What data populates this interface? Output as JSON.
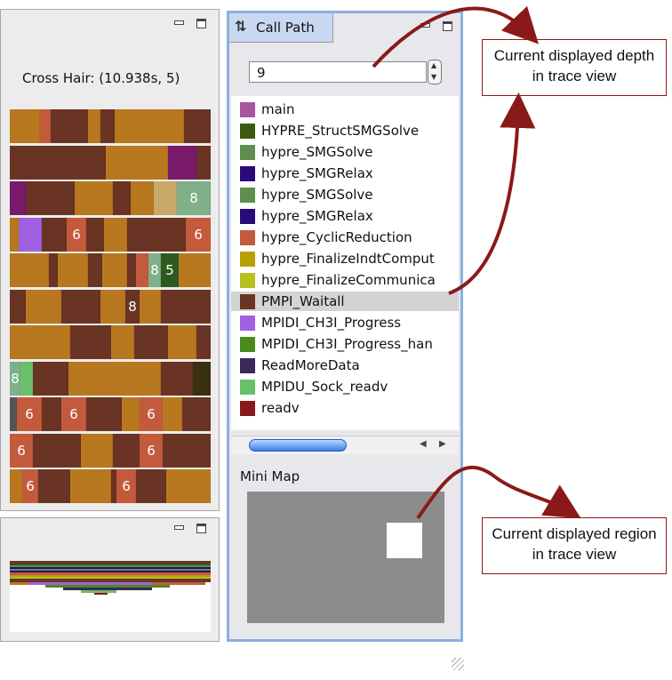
{
  "trace_view": {
    "crosshair_text": "Cross Hair: (10.938s, 5)",
    "rows": [
      [
        {
          "w": 34,
          "c": "#b8781f"
        },
        {
          "w": 12,
          "c": "#c45a3c"
        },
        {
          "w": 42,
          "c": "#6a3424"
        },
        {
          "w": 14,
          "c": "#b8781f"
        },
        {
          "w": 16,
          "c": "#6a3424"
        },
        {
          "w": 78,
          "c": "#b8781f"
        },
        {
          "w": 30,
          "c": "#6a3424"
        }
      ],
      [
        {
          "w": 108,
          "c": "#6a3424"
        },
        {
          "w": 70,
          "c": "#b8781f"
        },
        {
          "w": 32,
          "c": "#7a1a6a"
        },
        {
          "w": 16,
          "c": "#6a3424"
        }
      ],
      [
        {
          "w": 18,
          "c": "#7a1a6a"
        },
        {
          "w": 55,
          "c": "#6a3424"
        },
        {
          "w": 43,
          "c": "#b8781f"
        },
        {
          "w": 20,
          "c": "#6a3424"
        },
        {
          "w": 26,
          "c": "#b8781f"
        },
        {
          "w": 26,
          "c": "#c8a868"
        },
        {
          "w": 38,
          "c": "#7fb08a",
          "n": "8"
        }
      ],
      [
        {
          "w": 10,
          "c": "#b8781f"
        },
        {
          "w": 26,
          "c": "#a060e0"
        },
        {
          "w": 28,
          "c": "#6a3424"
        },
        {
          "w": 22,
          "c": "#c45a3c",
          "n": "6"
        },
        {
          "w": 20,
          "c": "#6a3424"
        },
        {
          "w": 26,
          "c": "#b8781f"
        },
        {
          "w": 66,
          "c": "#6a3424"
        },
        {
          "w": 28,
          "c": "#c45a3c",
          "n": "6"
        }
      ],
      [
        {
          "w": 44,
          "c": "#b8781f"
        },
        {
          "w": 10,
          "c": "#6a3424"
        },
        {
          "w": 34,
          "c": "#b8781f"
        },
        {
          "w": 16,
          "c": "#6a3424"
        },
        {
          "w": 28,
          "c": "#b8781f"
        },
        {
          "w": 10,
          "c": "#6a3424"
        },
        {
          "w": 14,
          "c": "#c45a3c"
        },
        {
          "w": 14,
          "c": "#7fb08a",
          "n": "8"
        },
        {
          "w": 20,
          "c": "#2f5a1f",
          "n": "5"
        },
        {
          "w": 36,
          "c": "#b8781f"
        }
      ],
      [
        {
          "w": 18,
          "c": "#6a3424"
        },
        {
          "w": 40,
          "c": "#b8781f"
        },
        {
          "w": 44,
          "c": "#6a3424"
        },
        {
          "w": 28,
          "c": "#b8781f"
        },
        {
          "w": 16,
          "c": "#6a3424",
          "n": "8"
        },
        {
          "w": 24,
          "c": "#b8781f"
        },
        {
          "w": 56,
          "c": "#6a3424"
        }
      ],
      [
        {
          "w": 68,
          "c": "#b8781f"
        },
        {
          "w": 46,
          "c": "#6a3424"
        },
        {
          "w": 26,
          "c": "#b8781f"
        },
        {
          "w": 38,
          "c": "#6a3424"
        },
        {
          "w": 32,
          "c": "#b8781f"
        },
        {
          "w": 16,
          "c": "#6a3424"
        }
      ],
      [
        {
          "w": 12,
          "c": "#7fb08a",
          "n": "8"
        },
        {
          "w": 14,
          "c": "#6abf6a"
        },
        {
          "w": 40,
          "c": "#6a3424"
        },
        {
          "w": 104,
          "c": "#b8781f"
        },
        {
          "w": 36,
          "c": "#6a3424"
        },
        {
          "w": 20,
          "c": "#3a3010"
        }
      ],
      [
        {
          "w": 8,
          "c": "#555555"
        },
        {
          "w": 28,
          "c": "#c45a3c",
          "n": "6"
        },
        {
          "w": 22,
          "c": "#6a3424"
        },
        {
          "w": 28,
          "c": "#c45a3c",
          "n": "6"
        },
        {
          "w": 40,
          "c": "#6a3424"
        },
        {
          "w": 20,
          "c": "#b8781f"
        },
        {
          "w": 26,
          "c": "#c45a3c",
          "n": "6"
        },
        {
          "w": 22,
          "c": "#b8781f"
        },
        {
          "w": 32,
          "c": "#6a3424"
        }
      ],
      [
        {
          "w": 26,
          "c": "#c45a3c",
          "n": "6"
        },
        {
          "w": 54,
          "c": "#6a3424"
        },
        {
          "w": 36,
          "c": "#b8781f"
        },
        {
          "w": 30,
          "c": "#6a3424"
        },
        {
          "w": 26,
          "c": "#c45a3c",
          "n": "6"
        },
        {
          "w": 54,
          "c": "#6a3424"
        }
      ],
      [
        {
          "w": 14,
          "c": "#b8781f"
        },
        {
          "w": 18,
          "c": "#c45a3c",
          "n": "6"
        },
        {
          "w": 36,
          "c": "#6a3424"
        },
        {
          "w": 46,
          "c": "#b8781f"
        },
        {
          "w": 6,
          "c": "#6a3424"
        },
        {
          "w": 22,
          "c": "#c45a3c",
          "n": "6"
        },
        {
          "w": 34,
          "c": "#6a3424"
        },
        {
          "w": 50,
          "c": "#b8781f"
        }
      ]
    ]
  },
  "call_path": {
    "tab_label": "Call Path",
    "depth_value": "9",
    "selected_index": 9,
    "items": [
      {
        "label": "main",
        "color": "#a855a0"
      },
      {
        "label": "HYPRE_StructSMGSolve",
        "color": "#3e5a10"
      },
      {
        "label": "hypre_SMGSolve",
        "color": "#5f8f4f"
      },
      {
        "label": "hypre_SMGRelax",
        "color": "#2a0a7a"
      },
      {
        "label": "hypre_SMGSolve",
        "color": "#5f8f4f"
      },
      {
        "label": "hypre_SMGRelax",
        "color": "#2a0a7a"
      },
      {
        "label": "hypre_CyclicReduction",
        "color": "#c45a3c"
      },
      {
        "label": "hypre_FinalizeIndtComput",
        "color": "#b8a000"
      },
      {
        "label": "hypre_FinalizeCommunica",
        "color": "#b8c020"
      },
      {
        "label": "PMPI_Waitall",
        "color": "#6a3424"
      },
      {
        "label": "MPIDI_CH3I_Progress",
        "color": "#a060e0"
      },
      {
        "label": "MPIDI_CH3I_Progress_han",
        "color": "#4a8a1a"
      },
      {
        "label": "ReadMoreData",
        "color": "#3a2a5a"
      },
      {
        "label": "MPIDU_Sock_readv",
        "color": "#6abf6a"
      },
      {
        "label": "readv",
        "color": "#8a1a1a"
      }
    ],
    "mini_map_label": "Mini Map"
  },
  "callouts": {
    "depth": "Current displayed depth in trace view",
    "region": "Current displayed region in trace view"
  },
  "colors": {
    "arrow": "#8a1a1a",
    "panel_border": "#8ab0e0"
  }
}
